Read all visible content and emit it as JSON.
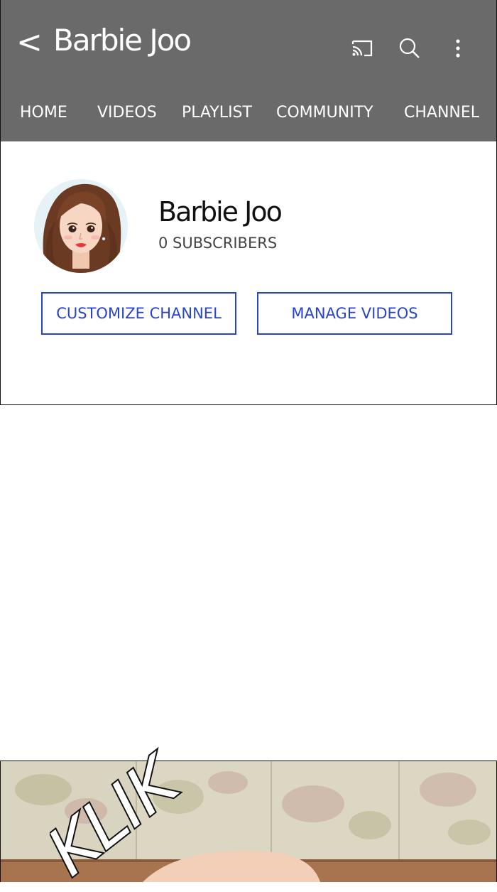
{
  "appbar": {
    "back_glyph": "<",
    "title": "Barbie Joo",
    "icons": [
      "cast-icon",
      "search-icon",
      "more-vert-icon"
    ],
    "background": "#6a6a6a"
  },
  "tabs": [
    {
      "label": "HOME"
    },
    {
      "label": "VIDEOS"
    },
    {
      "label": "PLAYLIST"
    },
    {
      "label": "COMMUNITY"
    },
    {
      "label": "CHANNEL"
    }
  ],
  "channel": {
    "name": "Barbie Joo",
    "subscribers": "0 SUBSCRIBERS"
  },
  "buttons": {
    "customize": "CUSTOMIZE CHANNEL",
    "manage": "MANAGE VIDEOS",
    "accent": "#2a44c8"
  },
  "comic": {
    "sound_effect": "KLIK"
  }
}
